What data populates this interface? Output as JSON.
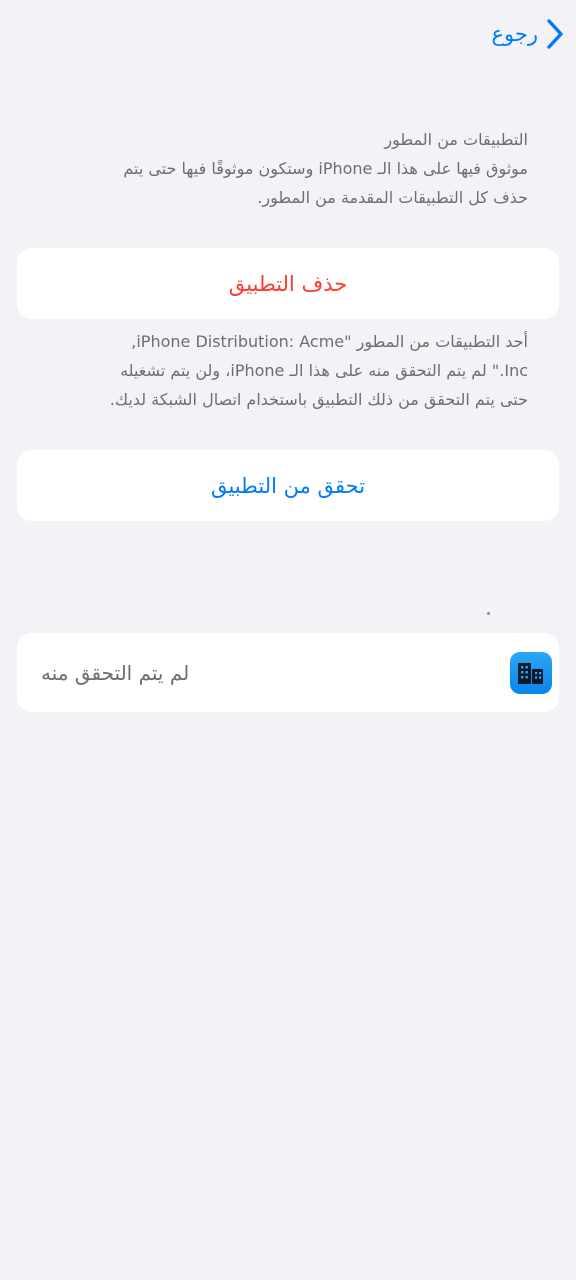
{
  "nav": {
    "back_label": "رجوع"
  },
  "description": {
    "lines": [
      "التطبيقات من المطور",
      "موثوق فيها على هذا الـ iPhone وستكون موثوقًا فيها حتى يتم",
      "حذف كل التطبيقات المقدمة من المطور."
    ]
  },
  "delete_button": {
    "label": "حذف التطبيق"
  },
  "verify_info": {
    "lines": [
      "أحد التطبيقات من المطور \"iPhone Distribution: Acme,",
      "Inc.\" لم يتم التحقق منه على هذا الـ iPhone، ولن يتم تشغيله",
      "حتى يتم التحقق من ذلك التطبيق باستخدام اتصال الشبكة لديك."
    ]
  },
  "verify_button": {
    "label": "تحقق من التطبيق"
  },
  "app_row": {
    "icon": "building-icon",
    "status": "لم يتم التحقق منه"
  },
  "colors": {
    "background": "#F2F2F7",
    "accent": "#007AFF",
    "destructive": "#FF3B30",
    "secondary_text": "#6D6D72"
  }
}
